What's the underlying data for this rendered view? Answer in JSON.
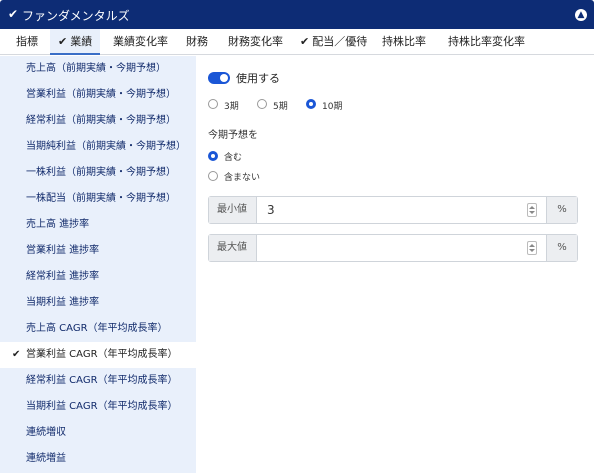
{
  "header": {
    "check_icon": "check-icon",
    "title": "ファンダメンタルズ",
    "toggle_icon": "chevron-up-icon"
  },
  "tabs": [
    {
      "label": "指標",
      "checked": false
    },
    {
      "label": "業績",
      "checked": true
    },
    {
      "label": "業績変化率",
      "checked": false
    },
    {
      "label": "財務",
      "checked": false
    },
    {
      "label": "財務変化率",
      "checked": false
    },
    {
      "label": "配当／優待",
      "checked": true
    },
    {
      "label": "持株比率",
      "checked": false
    },
    {
      "label": "持株比率変化率",
      "checked": false
    }
  ],
  "sidebar": {
    "items": [
      {
        "label": "売上高（前期実績・今期予想）"
      },
      {
        "label": "営業利益（前期実績・今期予想）"
      },
      {
        "label": "経常利益（前期実績・今期予想）"
      },
      {
        "label": "当期純利益（前期実績・今期予想）"
      },
      {
        "label": "一株利益（前期実績・今期予想）"
      },
      {
        "label": "一株配当（前期実績・今期予想）"
      },
      {
        "label": "売上高 進捗率"
      },
      {
        "label": "営業利益 進捗率"
      },
      {
        "label": "経常利益 進捗率"
      },
      {
        "label": "当期利益 進捗率"
      },
      {
        "label": "売上高 CAGR（年平均成長率）"
      },
      {
        "label": "営業利益 CAGR（年平均成長率）",
        "selected": true
      },
      {
        "label": "経常利益 CAGR（年平均成長率）"
      },
      {
        "label": "当期利益 CAGR（年平均成長率）"
      },
      {
        "label": "連続増収"
      },
      {
        "label": "連続増益"
      }
    ]
  },
  "content": {
    "use_toggle_label": "使用する",
    "use_toggle_on": true,
    "period_options": [
      "3期",
      "5期",
      "10期"
    ],
    "period_selected": "10期",
    "forecast_label": "今期予想を",
    "forecast_options": [
      "含む",
      "含まない"
    ],
    "forecast_selected": "含む",
    "min": {
      "prefix": "最小値",
      "value": "3",
      "suffix": "%"
    },
    "max": {
      "prefix": "最大値",
      "value": "",
      "suffix": "%"
    }
  },
  "colors": {
    "header_bg": "#0d2c75",
    "accent": "#1a56d6",
    "sidebar_bg": "#e9f0fb"
  }
}
